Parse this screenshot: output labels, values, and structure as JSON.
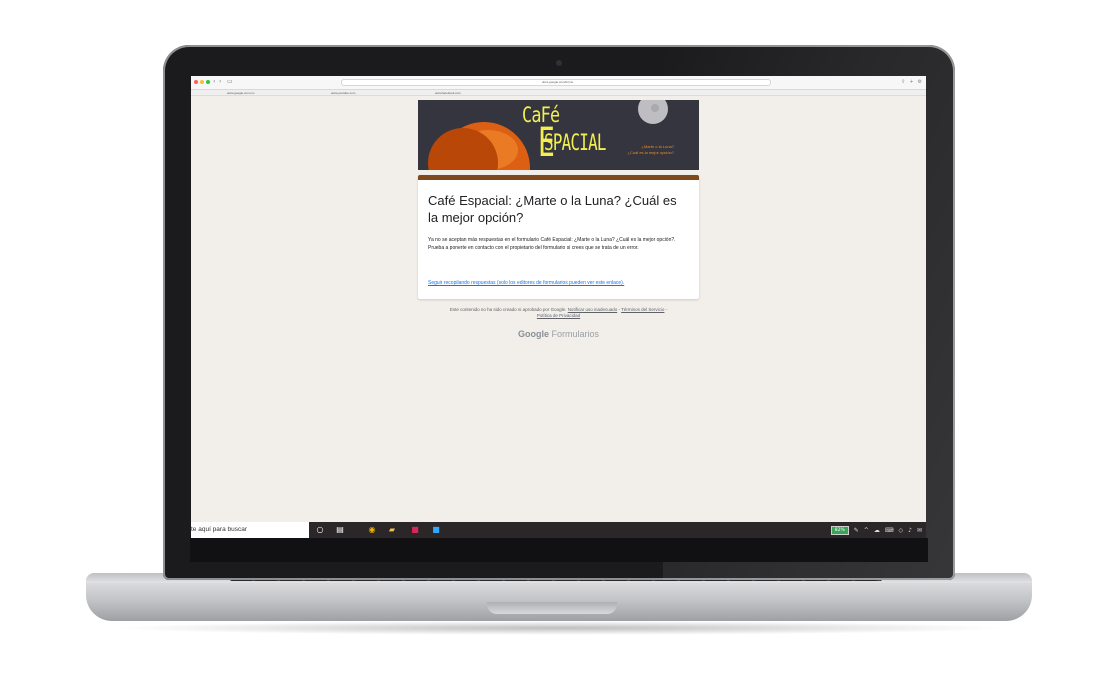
{
  "browser": {
    "url": "docs.google.com/forms",
    "bookmarks": [
      "www.google.com.mx",
      "www.youtube.com",
      "www.facebook.com"
    ],
    "traffic_light_colors": [
      "#ff5f56",
      "#ffbd2e",
      "#27c93f"
    ]
  },
  "banner": {
    "logo_cafe": "CaFé",
    "logo_e": "E",
    "logo_espacial": "SPACIAL",
    "tagline": "¿Marte o la Luna?\n¿Cuál es la mejor opción?"
  },
  "form": {
    "title": "Café Espacial: ¿Marte o la Luna? ¿Cuál es la mejor opción?",
    "closed_message": "Ya no se aceptan más respuestas en el formulario Café Espacial: ¿Marte o la Luna? ¿Cuál es la mejor opción?.",
    "contact_message": "Prueba a ponerte en contacto con el propietario del formulario si crees que se trata de un error.",
    "editors_link": "Seguir recopilando respuestas (solo los editores de formularios pueden ver este enlace)."
  },
  "footer": {
    "disclaimer": "Este contenido no ha sido creado ni aprobado por Google.",
    "report_link": "Notificar uso inadecuado",
    "terms_link": "Términos del Servicio",
    "privacy_link": "Política de Privacidad",
    "brand_google": "Google",
    "brand_forms": "Formularios"
  },
  "taskbar": {
    "search_placeholder": "te aquí para buscar",
    "battery": "82%",
    "apps": [
      "cortana-icon",
      "task-view-icon",
      "chrome-icon",
      "file-explorer-icon",
      "app-red-icon",
      "photoshop-icon"
    ]
  }
}
